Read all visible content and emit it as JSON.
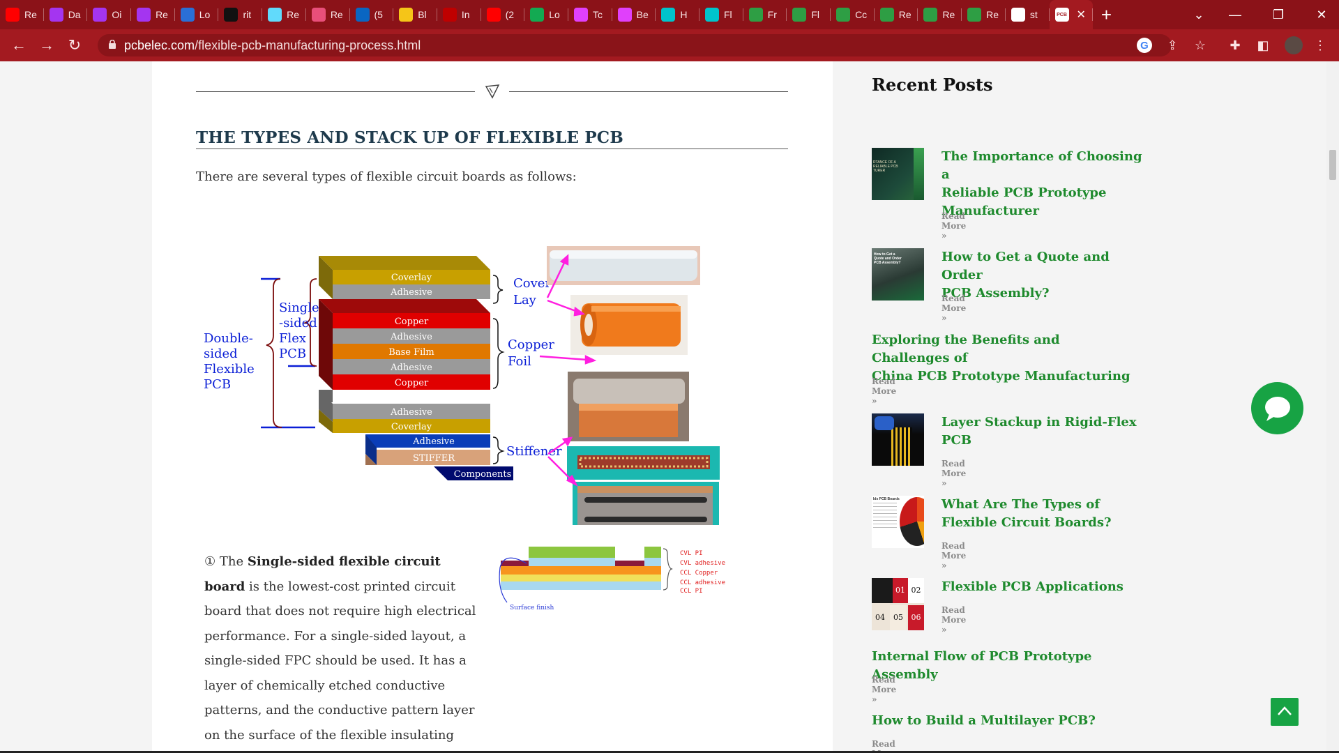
{
  "browser": {
    "tabs": [
      {
        "label": "Re",
        "icon": "youtube-icon",
        "color": "#ff0000"
      },
      {
        "label": "Da",
        "icon": "udemy-icon",
        "color": "#a435f0"
      },
      {
        "label": "Oi",
        "icon": "udemy-icon",
        "color": "#a435f0"
      },
      {
        "label": "Re",
        "icon": "udemy-icon",
        "color": "#a435f0"
      },
      {
        "label": "Lo",
        "icon": "dolphin-icon",
        "color": "#2a6fd6"
      },
      {
        "label": "rit",
        "icon": "github-icon",
        "color": "#111111"
      },
      {
        "label": "Re",
        "icon": "react-icon",
        "color": "#61dafb"
      },
      {
        "label": "Re",
        "icon": "gallery-icon",
        "color": "#e94f7a"
      },
      {
        "label": "(5",
        "icon": "linkedin-icon",
        "color": "#0a66c2"
      },
      {
        "label": "Bl",
        "icon": "bookmark-icon",
        "color": "#f5c518"
      },
      {
        "label": "In",
        "icon": "rakuten-icon",
        "color": "#bf0000"
      },
      {
        "label": "(2",
        "icon": "youtube-icon",
        "color": "#ff0000"
      },
      {
        "label": "Lo",
        "icon": "mongodb-icon",
        "color": "#13aa52"
      },
      {
        "label": "Tc",
        "icon": "ring-icon",
        "color": "#e040fb"
      },
      {
        "label": "Be",
        "icon": "ring-icon",
        "color": "#e040fb"
      },
      {
        "label": "H",
        "icon": "canva-icon",
        "color": "#00c4cc"
      },
      {
        "label": "Fl",
        "icon": "canva-icon",
        "color": "#00c4cc"
      },
      {
        "label": "Fr",
        "icon": "pcb-icon",
        "color": "#2e9e44"
      },
      {
        "label": "Fl",
        "icon": "pcb-icon",
        "color": "#2e9e44"
      },
      {
        "label": "Cc",
        "icon": "pcb-icon",
        "color": "#2e9e44"
      },
      {
        "label": "Re",
        "icon": "pcb-icon",
        "color": "#2e9e44"
      },
      {
        "label": "Re",
        "icon": "pcb-icon",
        "color": "#2e9e44"
      },
      {
        "label": "Re",
        "icon": "pcb-icon",
        "color": "#2e9e44"
      },
      {
        "label": "st",
        "icon": "google-icon",
        "color": "#ffffff"
      }
    ],
    "active_tab_icon": "PCB",
    "url_domain": "pcbelec.com",
    "url_path": "/flexible-pcb-manufacturing-process.html",
    "theme_color": "#a31a20"
  },
  "article": {
    "heading": "THE TYPES AND STACK UP OF FLEXIBLE PCB",
    "intro": "There are several types of flexible circuit boards as follows:",
    "diagram": {
      "layers": [
        "Coverlay",
        "Adhesive",
        "Copper",
        "Adhesive",
        "Base Film",
        "Adhesive",
        "Copper",
        "Adhesive",
        "Coverlay"
      ],
      "stiffener_layers": [
        "Adhesive",
        "STIFFER",
        "Components"
      ],
      "left_labels": {
        "single_lines": [
          "Single",
          "-sided",
          "Flex",
          "PCB"
        ],
        "double_lines": [
          "Double-",
          "sided",
          "Flexible",
          "PCB"
        ]
      },
      "right_labels": {
        "cover_lay": [
          "Cover",
          "Lay"
        ],
        "copper_foil": [
          "Copper",
          "Foil"
        ],
        "stiffener": "Stiffener"
      }
    },
    "paragraph": {
      "marker": "①",
      "pre": "The ",
      "bold": "Single-sided flexible circuit board",
      "rest": " is the lowest-cost printed circuit board that does not require high electrical performance. For a single-sided layout, a single-sided FPC should be used. It has a layer of chemically etched conductive patterns, and the conductive pattern layer on the surface of the flexible insulating substrate is a rolled"
    },
    "schematic": {
      "labels": [
        "CVL PI",
        "CVL adhesive",
        "CCL Copper",
        "CCL adhesive",
        "CCL PI"
      ],
      "surface_finish": "Surface finish"
    }
  },
  "sidebar": {
    "title": "Recent Posts",
    "read_more": "Read More »",
    "posts": [
      {
        "title": "The Importance of Choosing a Reliable PCB Prototype Manufacturer",
        "lines": [
          "The Importance of Choosing a",
          "Reliable PCB Prototype",
          "Manufacturer"
        ],
        "thumb_text": "RTANCE OF A RELIABLE PCB TURER"
      },
      {
        "title": "How to Get a Quote and Order PCB Assembly?",
        "lines": [
          "How to Get a Quote and Order",
          "PCB Assembly?"
        ],
        "thumb_text": "How to Get a Quote and Order PCB Assembly?"
      },
      {
        "title": "Exploring the Benefits and Challenges of China PCB Prototype Manufacturing",
        "lines": [
          "Exploring the Benefits and Challenges of",
          "China PCB Prototype Manufacturing"
        ]
      },
      {
        "title": "Layer Stackup in Rigid-Flex PCB",
        "lines": [
          "Layer Stackup in Rigid-Flex",
          "PCB"
        ]
      },
      {
        "title": "What Are The Types of Flexible Circuit Boards?",
        "lines": [
          "What Are The Types of",
          "Flexible Circuit Boards?"
        ],
        "thumb_text": "Idx PCB Boards"
      },
      {
        "title": "Flexible PCB Applications",
        "lines": [
          "Flexible PCB Applications"
        ],
        "thumb_numbers": [
          "01",
          "02",
          "04",
          "05",
          "06"
        ]
      },
      {
        "title": "Internal Flow of PCB Prototype Assembly",
        "lines": [
          "Internal Flow of PCB Prototype Assembly"
        ]
      },
      {
        "title": "How to Build a Multilayer PCB?",
        "lines": [
          "How to Build a Multilayer PCB?"
        ]
      }
    ]
  },
  "colors": {
    "accent_green": "#1e8a2d",
    "widget_green": "#17a344",
    "heading_navy": "#1e3a4c"
  }
}
